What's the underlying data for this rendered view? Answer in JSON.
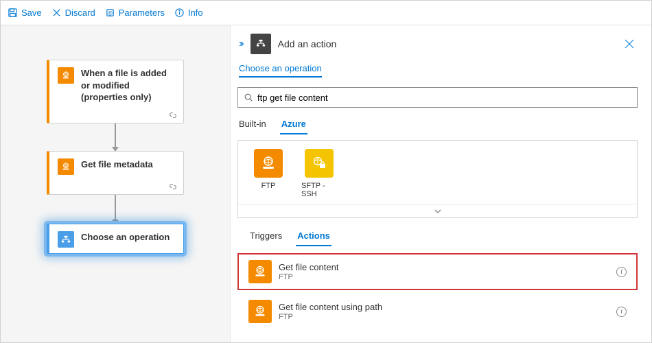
{
  "toolbar": {
    "save": "Save",
    "discard": "Discard",
    "parameters": "Parameters",
    "info": "Info"
  },
  "workflow": {
    "trigger": {
      "title": "When a file is added or modified (properties only)"
    },
    "step1": {
      "title": "Get file metadata"
    },
    "step2": {
      "title": "Choose an operation"
    }
  },
  "panel": {
    "title": "Add an action",
    "section": "Choose an operation",
    "search_value": "ftp get file content",
    "tabs": {
      "builtin": "Built-in",
      "azure": "Azure"
    },
    "connectors": {
      "ftp": "FTP",
      "sftp": "SFTP - SSH"
    },
    "subtabs": {
      "triggers": "Triggers",
      "actions": "Actions"
    },
    "actions": [
      {
        "title": "Get file content",
        "sub": "FTP"
      },
      {
        "title": "Get file content using path",
        "sub": "FTP"
      }
    ]
  }
}
